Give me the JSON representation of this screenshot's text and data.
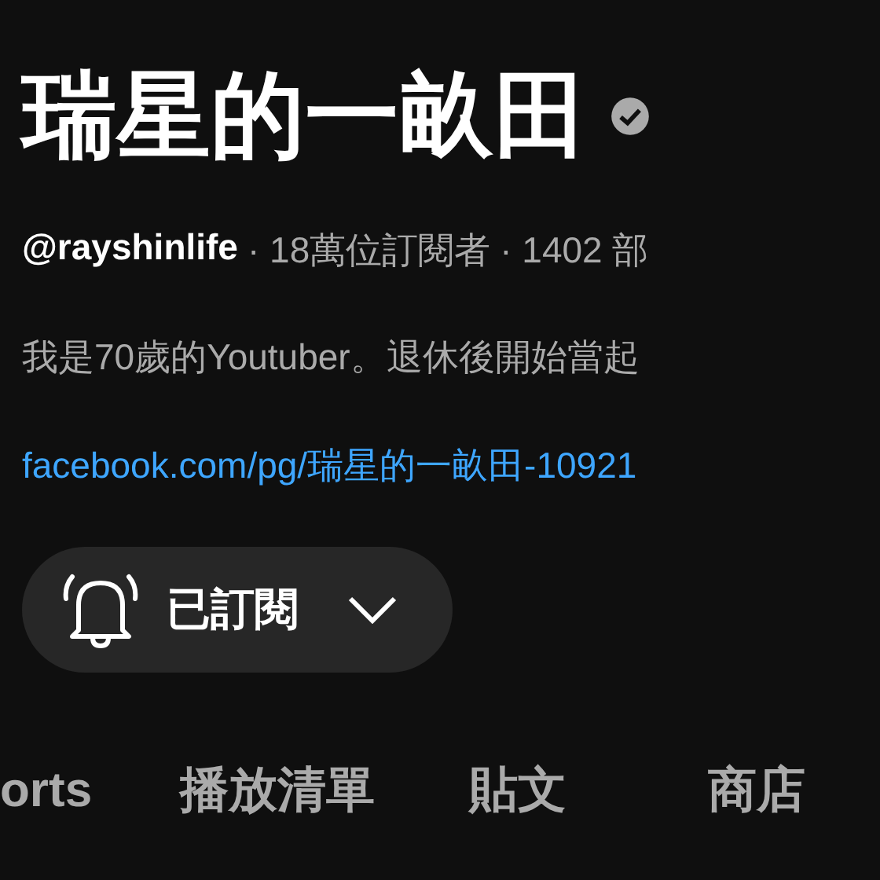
{
  "channel": {
    "name": "瑞星的一畝田",
    "verified": true,
    "handle": "@rayshinlife",
    "subscribers": "· 18萬位訂閱者",
    "videos": "· 1402 部",
    "description": "我是70歲的Youtuber。退休後開始當起",
    "link": "facebook.com/pg/瑞星的一畝田-10921"
  },
  "subscribe_button": {
    "label": "已訂閱"
  },
  "tabs": [
    {
      "label": "orts"
    },
    {
      "label": "播放清單"
    },
    {
      "label": "貼文"
    },
    {
      "label": "商店"
    }
  ]
}
